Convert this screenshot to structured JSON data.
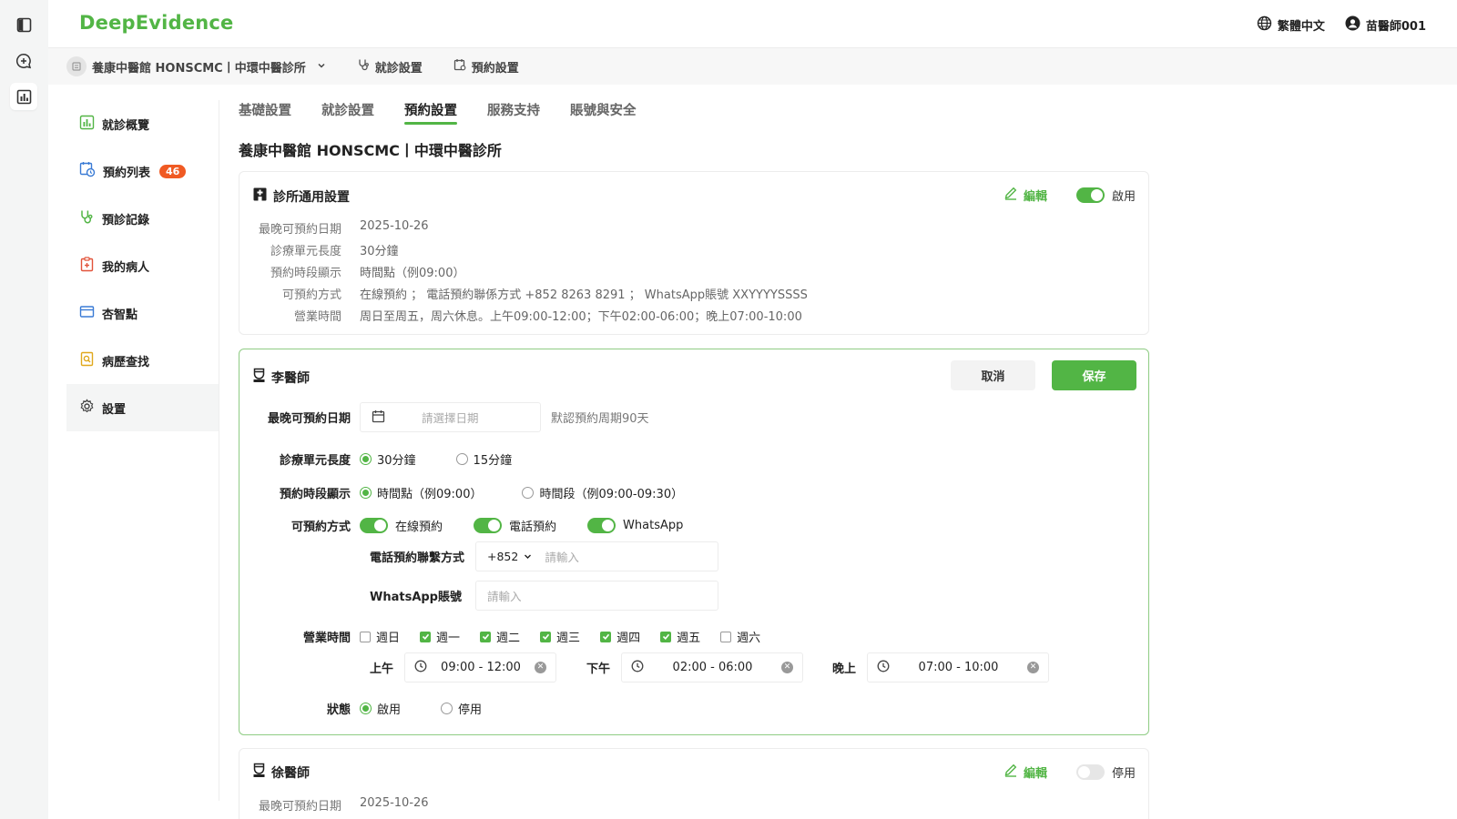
{
  "brand": {
    "name": "DeepEvidence",
    "color": "#52b545"
  },
  "header": {
    "language": "繁體中文",
    "user": "苗醫師001"
  },
  "subbar": {
    "org": "養康中醫館 HONSCMC丨中環中醫診所",
    "clinic_settings": "就診設置",
    "appointment_settings": "預約設置"
  },
  "sidebar": {
    "items": [
      {
        "label": "就診概覽",
        "icon": "chart-icon"
      },
      {
        "label": "預約列表",
        "icon": "calendar-clock-icon",
        "badge": "46"
      },
      {
        "label": "預診記錄",
        "icon": "stethoscope-icon"
      },
      {
        "label": "我的病人",
        "icon": "patient-card-icon"
      },
      {
        "label": "杏智點",
        "icon": "wallet-icon"
      },
      {
        "label": "病歷查找",
        "icon": "record-search-icon"
      },
      {
        "label": "設置",
        "icon": "gear-icon"
      }
    ],
    "active": "設置"
  },
  "tabs": [
    "基礎設置",
    "就診設置",
    "預約設置",
    "服務支持",
    "賬號與安全"
  ],
  "active_tab": "預約設置",
  "page_title": "養康中醫館 HONSCMC丨中環中醫診所",
  "general": {
    "title": "診所通用設置",
    "edit": "編輯",
    "toggle_label": "啟用",
    "rows": [
      {
        "k": "最晚可預約日期",
        "v": "2025-10-26"
      },
      {
        "k": "診療單元長度",
        "v": "30分鐘"
      },
      {
        "k": "預約時段顯示",
        "v": "時間點（例09:00）"
      },
      {
        "k": "可預約方式",
        "v": "在線預約 ； 電話預約聯係方式 +852 8263 8291 ； WhatsApp賬號 XXYYYYSSSS"
      },
      {
        "k": "營業時間",
        "v": "周日至周五，周六休息。上午09:00-12:00；下午02:00-06:00；晚上07:00-10:00"
      }
    ]
  },
  "doctor_edit": {
    "name": "李醫師",
    "cancel": "取消",
    "save": "保存",
    "latest_date_label": "最晚可預約日期",
    "date_placeholder": "請選擇日期",
    "date_hint": "默認預約周期90天",
    "unit_label": "診療單元長度",
    "unit_options": [
      "30分鐘",
      "15分鐘"
    ],
    "display_label": "預約時段顯示",
    "display_options": [
      "時間點（例09:00）",
      "時間段（例09:00-09:30）"
    ],
    "methods_label": "可預約方式",
    "methods": [
      "在線預約",
      "電話預約",
      "WhatsApp"
    ],
    "phone_label": "電話預約聯繫方式",
    "phone_code": "+852",
    "phone_placeholder": "請輸入",
    "whatsapp_label": "WhatsApp賬號",
    "whatsapp_placeholder": "請輸入",
    "hours_label": "營業時間",
    "days": [
      {
        "label": "週日",
        "checked": false
      },
      {
        "label": "週一",
        "checked": true
      },
      {
        "label": "週二",
        "checked": true
      },
      {
        "label": "週三",
        "checked": true
      },
      {
        "label": "週四",
        "checked": true
      },
      {
        "label": "週五",
        "checked": true
      },
      {
        "label": "週六",
        "checked": false
      }
    ],
    "am_label": "上午",
    "am_range": "09:00 - 12:00",
    "pm_label": "下午",
    "pm_range": "02:00 - 06:00",
    "eve_label": "晚上",
    "eve_range": "07:00 - 10:00",
    "status_label": "狀態",
    "status_options": [
      "啟用",
      "停用"
    ]
  },
  "doctor2": {
    "name": "徐醫師",
    "edit": "編輯",
    "toggle_label": "停用",
    "rows": [
      {
        "k": "最晚可預約日期",
        "v": "2025-10-26"
      }
    ]
  }
}
